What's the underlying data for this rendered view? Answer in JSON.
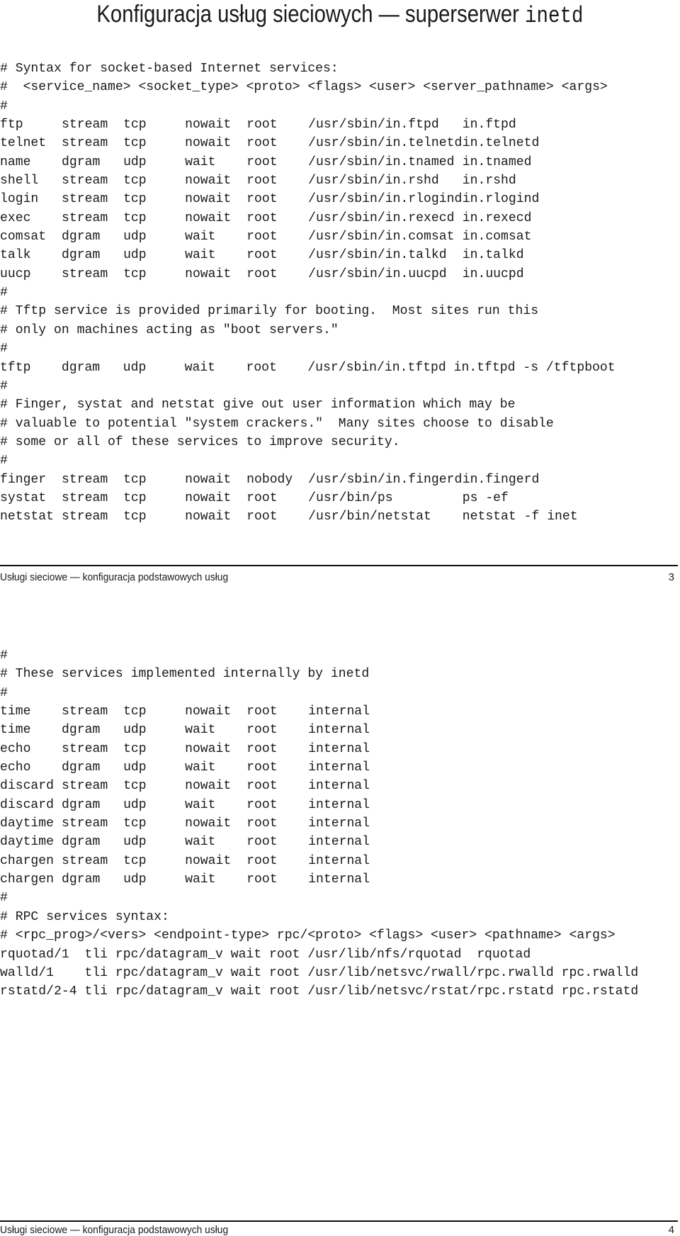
{
  "pages": [
    {
      "number": "3",
      "title": {
        "text": "Konfiguracja usług sieciowych — superserwer ",
        "code": "inetd"
      },
      "lines": [
        {
          "type": "text",
          "text": "# Syntax for socket-based Internet services:"
        },
        {
          "type": "text",
          "text": "#  <service_name> <socket_type> <proto> <flags> <user> <server_pathname> <args>"
        },
        {
          "type": "text",
          "text": "#"
        },
        {
          "type": "row",
          "cells": [
            "ftp",
            "stream",
            "tcp",
            "nowait",
            "root",
            "/usr/sbin/in.ftpd",
            "in.ftpd"
          ]
        },
        {
          "type": "row",
          "cells": [
            "telnet",
            "stream",
            "tcp",
            "nowait",
            "root",
            "/usr/sbin/in.telnetd",
            "in.telnetd"
          ]
        },
        {
          "type": "row",
          "cells": [
            "name",
            "dgram",
            "udp",
            "wait",
            "root",
            "/usr/sbin/in.tnamed",
            "in.tnamed"
          ]
        },
        {
          "type": "row",
          "cells": [
            "shell",
            "stream",
            "tcp",
            "nowait",
            "root",
            "/usr/sbin/in.rshd",
            "in.rshd"
          ]
        },
        {
          "type": "row",
          "cells": [
            "login",
            "stream",
            "tcp",
            "nowait",
            "root",
            "/usr/sbin/in.rlogind",
            "in.rlogind"
          ]
        },
        {
          "type": "row",
          "cells": [
            "exec",
            "stream",
            "tcp",
            "nowait",
            "root",
            "/usr/sbin/in.rexecd",
            "in.rexecd"
          ]
        },
        {
          "type": "row",
          "cells": [
            "comsat",
            "dgram",
            "udp",
            "wait",
            "root",
            "/usr/sbin/in.comsat",
            "in.comsat"
          ]
        },
        {
          "type": "row",
          "cells": [
            "talk",
            "dgram",
            "udp",
            "wait",
            "root",
            "/usr/sbin/in.talkd",
            "in.talkd"
          ]
        },
        {
          "type": "row",
          "cells": [
            "uucp",
            "stream",
            "tcp",
            "nowait",
            "root",
            "/usr/sbin/in.uucpd",
            "in.uucpd"
          ]
        },
        {
          "type": "text",
          "text": "#"
        },
        {
          "type": "text",
          "text": "# Tftp service is provided primarily for booting.  Most sites run this"
        },
        {
          "type": "text",
          "text": "# only on machines acting as \"boot servers.\""
        },
        {
          "type": "text",
          "text": "#"
        },
        {
          "type": "text",
          "text": "tftp    dgram   udp     wait    root    /usr/sbin/in.tftpd in.tftpd -s /tftpboot"
        },
        {
          "type": "text",
          "text": "#"
        },
        {
          "type": "text",
          "text": "# Finger, systat and netstat give out user information which may be"
        },
        {
          "type": "text",
          "text": "# valuable to potential \"system crackers.\"  Many sites choose to disable"
        },
        {
          "type": "text",
          "text": "# some or all of these services to improve security."
        },
        {
          "type": "text",
          "text": "#"
        },
        {
          "type": "row",
          "cells": [
            "finger",
            "stream",
            "tcp",
            "nowait",
            "nobody",
            "/usr/sbin/in.fingerd",
            "in.fingerd"
          ]
        },
        {
          "type": "row",
          "cells": [
            "systat",
            "stream",
            "tcp",
            "nowait",
            "root",
            "/usr/bin/ps",
            "ps -ef"
          ]
        },
        {
          "type": "row",
          "cells": [
            "netstat",
            "stream",
            "tcp",
            "nowait",
            "root",
            "/usr/bin/netstat",
            "netstat -f inet"
          ]
        }
      ],
      "footer": "Usługi sieciowe — konfiguracja podstawowych usług"
    },
    {
      "number": "4",
      "lines": [
        {
          "type": "text",
          "text": "#"
        },
        {
          "type": "text",
          "text": "# These services implemented internally by inetd"
        },
        {
          "type": "text",
          "text": "#"
        },
        {
          "type": "row",
          "cells": [
            "time",
            "stream",
            "tcp",
            "nowait",
            "root",
            "internal"
          ]
        },
        {
          "type": "row",
          "cells": [
            "time",
            "dgram",
            "udp",
            "wait",
            "root",
            "internal"
          ]
        },
        {
          "type": "row",
          "cells": [
            "echo",
            "stream",
            "tcp",
            "nowait",
            "root",
            "internal"
          ]
        },
        {
          "type": "row",
          "cells": [
            "echo",
            "dgram",
            "udp",
            "wait",
            "root",
            "internal"
          ]
        },
        {
          "type": "row",
          "cells": [
            "discard",
            "stream",
            "tcp",
            "nowait",
            "root",
            "internal"
          ]
        },
        {
          "type": "row",
          "cells": [
            "discard",
            "dgram",
            "udp",
            "wait",
            "root",
            "internal"
          ]
        },
        {
          "type": "row",
          "cells": [
            "daytime",
            "stream",
            "tcp",
            "nowait",
            "root",
            "internal"
          ]
        },
        {
          "type": "row",
          "cells": [
            "daytime",
            "dgram",
            "udp",
            "wait",
            "root",
            "internal"
          ]
        },
        {
          "type": "row",
          "cells": [
            "chargen",
            "stream",
            "tcp",
            "nowait",
            "root",
            "internal"
          ]
        },
        {
          "type": "row",
          "cells": [
            "chargen",
            "dgram",
            "udp",
            "wait",
            "root",
            "internal"
          ]
        },
        {
          "type": "text",
          "text": "#"
        },
        {
          "type": "text",
          "text": "# RPC services syntax:"
        },
        {
          "type": "text",
          "text": "# <rpc_prog>/<vers> <endpoint-type> rpc/<proto> <flags> <user> <pathname> <args>"
        },
        {
          "type": "text",
          "text": "rquotad/1  tli rpc/datagram_v wait root /usr/lib/nfs/rquotad  rquotad"
        },
        {
          "type": "text",
          "text": "walld/1    tli rpc/datagram_v wait root /usr/lib/netsvc/rwall/rpc.rwalld rpc.rwalld"
        },
        {
          "type": "text",
          "text": "rstatd/2-4 tli rpc/datagram_v wait root /usr/lib/netsvc/rstat/rpc.rstatd rpc.rstatd"
        }
      ],
      "footer": "Usługi sieciowe — konfiguracja podstawowych usług"
    }
  ]
}
